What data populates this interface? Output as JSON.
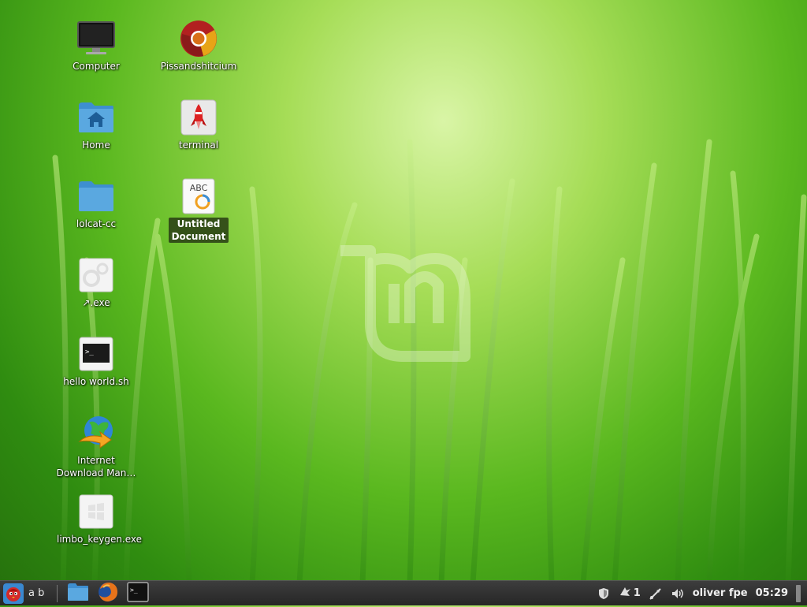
{
  "desktop": {
    "icons": [
      {
        "label": "Computer"
      },
      {
        "label": "Pissandshitcium"
      },
      {
        "label": "Home"
      },
      {
        "label": "terminal"
      },
      {
        "label": "lolcat-cc"
      },
      {
        "label": "Untitled Document"
      },
      {
        "label": "↗.exe"
      },
      {
        "label": "hello world.sh"
      },
      {
        "label": "Internet Download Man…"
      },
      {
        "label": "limbo_keygen.exe"
      }
    ]
  },
  "taskbar": {
    "menu_label": "a b",
    "launchers": [
      "files-icon",
      "firefox-icon",
      "terminal-icon"
    ],
    "tray": {
      "notifications_count": "1",
      "user": "oliver fpe",
      "clock": "05:29"
    }
  },
  "colors": {
    "panel": "#2e2e2e",
    "wallpaper_accent": "#5ab81f",
    "selection": "#2c3c14"
  }
}
